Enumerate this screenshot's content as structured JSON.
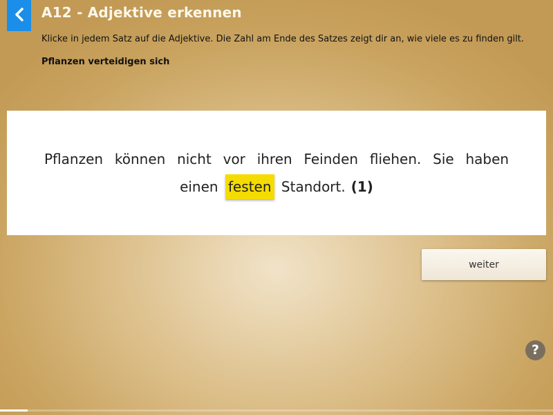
{
  "header": {
    "title": "A12 - Adjektive erkennen",
    "instruction": "Klicke in jedem Satz auf die Adjektive. Die Zahl am Ende des Satzes zeigt dir an, wie viele es zu finden gilt.",
    "subtitle": "Pflanzen verteidigen sich",
    "back_icon": "chevron-left-icon"
  },
  "exercise": {
    "words": [
      "Pflanzen",
      "können",
      "nicht",
      "vor",
      "ihren",
      "Feinden",
      "fliehen.",
      "Sie",
      "haben",
      "einen",
      "festen",
      "Standort."
    ],
    "selected_word": "festen",
    "count_label": "(1)"
  },
  "actions": {
    "next_label": "weiter",
    "help_glyph": "?"
  },
  "progress": {
    "fraction": 0.05
  },
  "colors": {
    "accent_blue": "#1a8ee8",
    "highlight_yellow": "#f5dc00",
    "background_tan": "#c9a35f",
    "help_gray": "#7a6f5f"
  }
}
